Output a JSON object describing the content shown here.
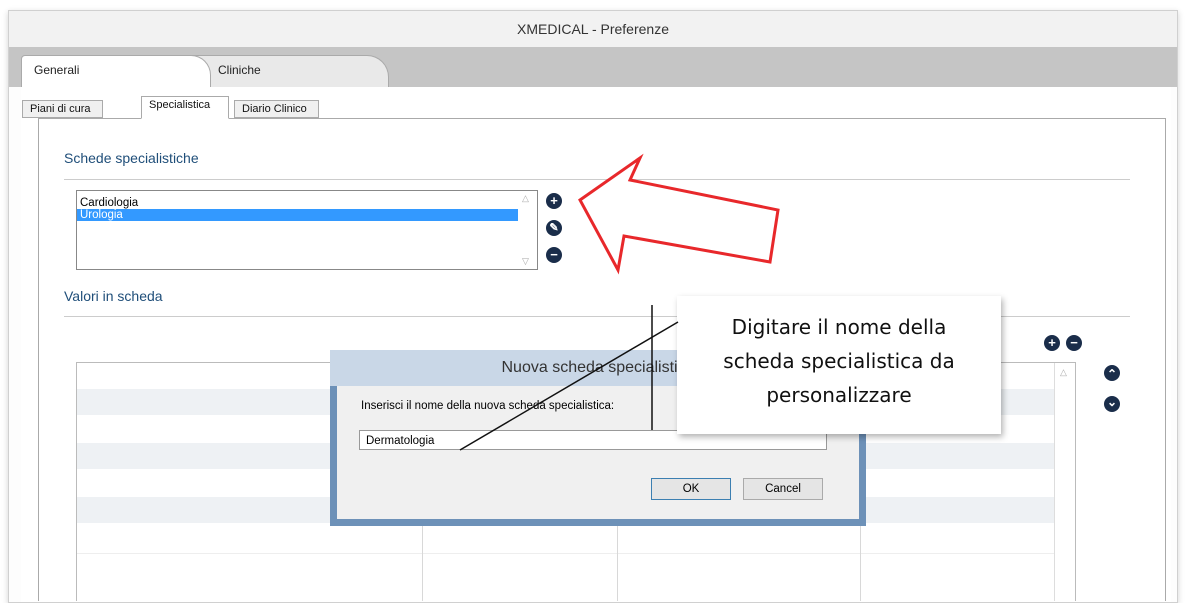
{
  "window": {
    "title": "XMEDICAL - Preferenze"
  },
  "main_tabs": [
    "Generali",
    "Cliniche"
  ],
  "sub_tabs": [
    "Piani di cura",
    "Specialistica",
    "Diario Clinico"
  ],
  "schede": {
    "title": "Schede specialistiche",
    "items": [
      "Cardiologia",
      "Urologia"
    ],
    "selected": "Urologia",
    "buttons": {
      "add": "+",
      "edit": "✎",
      "remove": "−"
    }
  },
  "valori": {
    "title": "Valori in scheda",
    "buttons": {
      "add": "+",
      "remove": "−",
      "up": "⌃",
      "down": "⌄"
    }
  },
  "dialog": {
    "title": "Nuova scheda specialistica",
    "prompt": "Inserisci il nome della nuova scheda specialistica:",
    "value": "Dermatologia",
    "ok": "OK",
    "cancel": "Cancel"
  },
  "callout": {
    "line1": "Digitare il nome della",
    "line2": "scheda specialistica da",
    "line3": "personalizzare"
  },
  "colors": {
    "arrow": "#e8282b",
    "selection": "#3399ff",
    "dialog_frame": "#6d91b8",
    "icon": "#1a2d4a"
  }
}
